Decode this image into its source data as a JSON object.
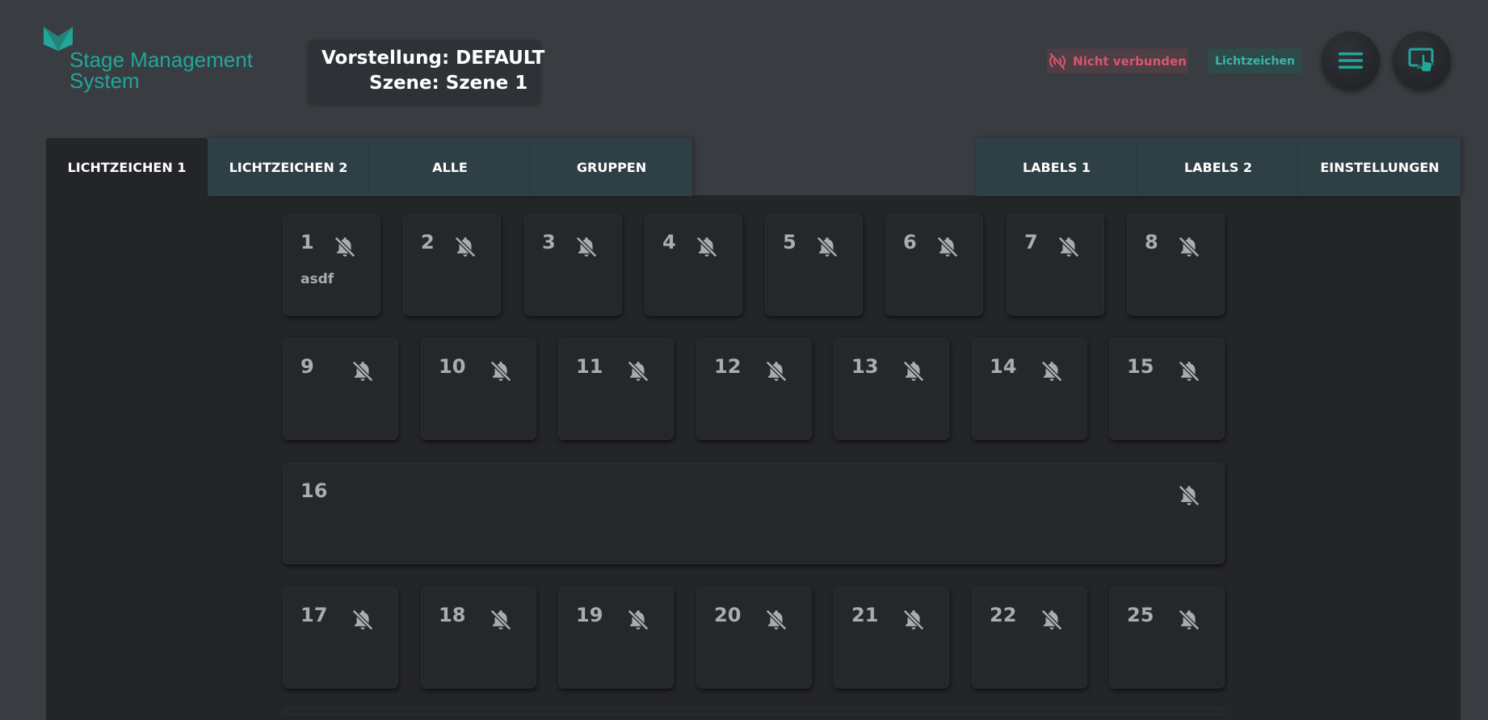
{
  "app": {
    "logo_line1": "Stage Management",
    "logo_line2": "System"
  },
  "show_info": {
    "show_label": "Vorstellung:",
    "show_value": "DEFAULT",
    "scene_label": "Szene:",
    "scene_value": "Szene 1"
  },
  "status": {
    "connection": "Nicht verbunden",
    "mode": "Lichtzeichen"
  },
  "icons": {
    "connection": "signal-off-icon",
    "menu": "menu-icon",
    "display": "screen-touch-icon",
    "tile": "bell-off-icon"
  },
  "colors": {
    "accent": "#23a69a",
    "error": "#d9566b",
    "tab_bg": "#2e4045",
    "panel_bg": "#232528",
    "tile_text": "#a9acb0"
  },
  "tabs": [
    {
      "label": "LICHTZEICHEN 1",
      "active": true
    },
    {
      "label": "LICHTZEICHEN 2",
      "active": false
    },
    {
      "label": "ALLE",
      "active": false
    },
    {
      "label": "GRUPPEN",
      "active": false
    },
    {
      "label": "LABELS 1",
      "active": false
    },
    {
      "label": "LABELS 2",
      "active": false
    },
    {
      "label": "EINSTELLUNGEN",
      "active": false
    }
  ],
  "tiles": [
    {
      "number": "1",
      "label": "asdf"
    },
    {
      "number": "2",
      "label": ""
    },
    {
      "number": "3",
      "label": ""
    },
    {
      "number": "4",
      "label": ""
    },
    {
      "number": "5",
      "label": ""
    },
    {
      "number": "6",
      "label": ""
    },
    {
      "number": "7",
      "label": ""
    },
    {
      "number": "8",
      "label": ""
    },
    {
      "number": "9",
      "label": ""
    },
    {
      "number": "10",
      "label": ""
    },
    {
      "number": "11",
      "label": ""
    },
    {
      "number": "12",
      "label": ""
    },
    {
      "number": "13",
      "label": ""
    },
    {
      "number": "14",
      "label": ""
    },
    {
      "number": "15",
      "label": ""
    },
    {
      "number": "16",
      "label": ""
    },
    {
      "number": "17",
      "label": ""
    },
    {
      "number": "18",
      "label": ""
    },
    {
      "number": "19",
      "label": ""
    },
    {
      "number": "20",
      "label": ""
    },
    {
      "number": "21",
      "label": ""
    },
    {
      "number": "22",
      "label": ""
    },
    {
      "number": "25",
      "label": ""
    }
  ]
}
